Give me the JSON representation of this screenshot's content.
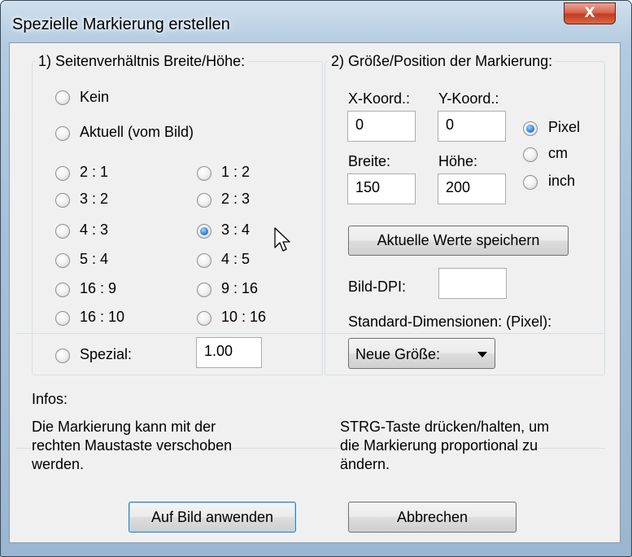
{
  "window": {
    "title": "Spezielle Markierung erstellen",
    "close_label": "X"
  },
  "aspect": {
    "legend": "1) Seitenverhältnis Breite/Höhe:",
    "kein_label": "Kein",
    "aktuell_label": "Aktuell (vom Bild)",
    "ratios_left": [
      "2 : 1",
      "3 : 2",
      "4 : 3",
      "5 : 4",
      "16 : 9",
      "16 : 10"
    ],
    "ratios_right": [
      "1 : 2",
      "2 : 3",
      "3 : 4",
      "4 : 5",
      "9 : 16",
      "10 : 16"
    ],
    "selected": "3 : 4",
    "spezial_label": "Spezial:",
    "spezial_value": "1.00"
  },
  "size": {
    "legend": "2) Größe/Position der Markierung:",
    "x_label": "X-Koord.:",
    "y_label": "Y-Koord.:",
    "x_value": "0",
    "y_value": "0",
    "breite_label": "Breite:",
    "hoehe_label": "Höhe:",
    "breite_value": "150",
    "hoehe_value": "200",
    "units": [
      "Pixel",
      "cm",
      "inch"
    ],
    "unit_selected": "Pixel",
    "save_button": "Aktuelle Werte speichern",
    "dpi_label": "Bild-DPI:",
    "dpi_value": "",
    "std_dim_label": "Standard-Dimensionen: (Pixel):",
    "std_dim_select": "Neue Größe:"
  },
  "infos": {
    "heading": "Infos:",
    "left_text": [
      "Die Markierung kann mit der",
      "rechten Maustaste verschoben",
      "werden."
    ],
    "right_text": [
      "STRG-Taste drücken/halten, um",
      "die Markierung proportional zu",
      "ändern."
    ]
  },
  "buttons": {
    "apply": "Auf Bild anwenden",
    "cancel": "Abbrechen"
  }
}
